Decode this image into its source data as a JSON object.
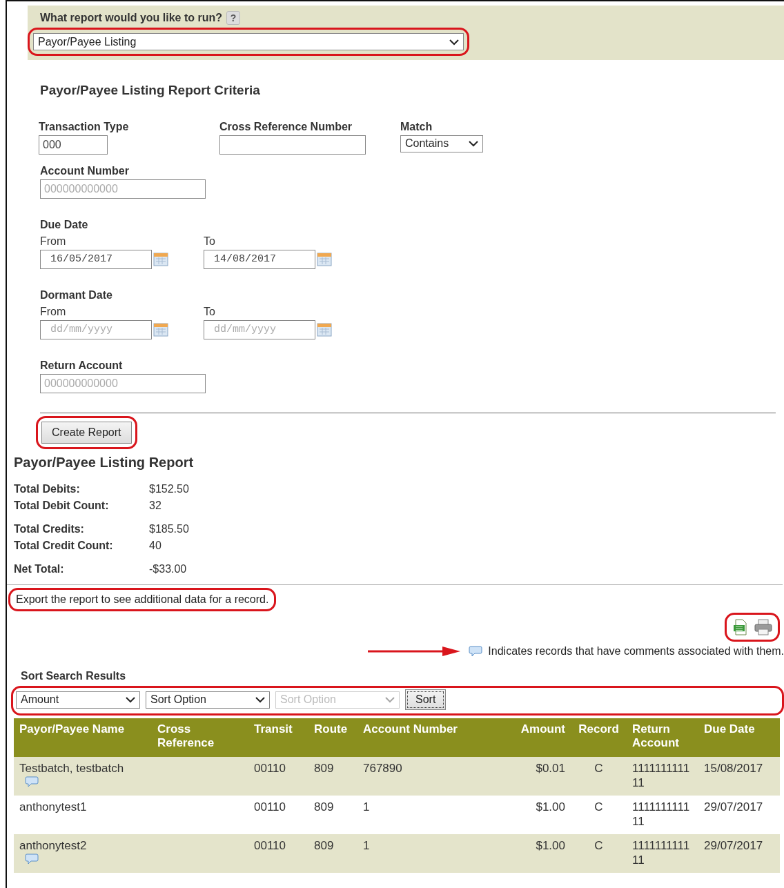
{
  "report_picker": {
    "label": "What report would you like to run?",
    "help": "?",
    "value": "Payor/Payee Listing",
    "highlighted": true
  },
  "criteria": {
    "title": "Payor/Payee Listing Report Criteria",
    "row": [
      {
        "kind": "input",
        "label": "Transaction Type",
        "value": "000"
      },
      {
        "kind": "input",
        "label": "Cross Reference Number"
      },
      {
        "kind": "select",
        "label": "Match",
        "value": "Contains"
      }
    ],
    "account_number": {
      "label": "Account Number",
      "placeholder": "000000000000"
    },
    "date_groups": [
      {
        "label": "Due Date",
        "from": {
          "label": "From",
          "value": "16/05/2017"
        },
        "to": {
          "label": "To",
          "value": "14/08/2017"
        }
      },
      {
        "label": "Dormant Date",
        "from": {
          "label": "From",
          "placeholder": "dd/mm/yyyy"
        },
        "to": {
          "label": "To",
          "placeholder": "dd/mm/yyyy"
        }
      }
    ],
    "return_account": {
      "label": "Return Account",
      "placeholder": "000000000000"
    }
  },
  "create_button": {
    "label": "Create Report",
    "highlighted": true
  },
  "report": {
    "title": "Payor/Payee Listing Report",
    "total_groups": [
      [
        {
          "label": "Total Debits:",
          "value": "$152.50"
        },
        {
          "label": "Total Debit Count:",
          "value": "32"
        }
      ],
      [
        {
          "label": "Total Credits:",
          "value": "$185.50"
        },
        {
          "label": "Total Credit Count:",
          "value": "40"
        }
      ],
      [
        {
          "label": "Net Total:",
          "value": "-$33.00"
        }
      ]
    ]
  },
  "export_note": {
    "text": "Export the report to see additional data for a record.",
    "highlighted": true
  },
  "export_tools": {
    "highlighted": true
  },
  "legend": {
    "text": "Indicates records that have comments associated with them.",
    "arrow": true
  },
  "sort": {
    "title": "Sort Search Results",
    "highlighted": true,
    "selects": [
      {
        "value": "Amount",
        "disabled": false
      },
      {
        "value": "Sort Option",
        "disabled": false
      },
      {
        "value": "Sort Option",
        "disabled": true
      }
    ],
    "button": "Sort"
  },
  "table": {
    "columns": [
      "Payor/Payee Name",
      "Cross Reference",
      "Transit",
      "Route",
      "Account Number",
      "Amount",
      "Record",
      "Return Account",
      "Due Date"
    ],
    "rows": [
      {
        "cells": [
          "Testbatch, testbatch",
          "",
          "00110",
          "809",
          "767890",
          "$0.01",
          "C",
          "111111111111",
          "15/08/2017"
        ],
        "has_comment": true
      },
      {
        "cells": [
          "anthonytest1",
          "",
          "00110",
          "809",
          "1",
          "$1.00",
          "C",
          "111111111111",
          "29/07/2017"
        ],
        "has_comment": false
      },
      {
        "cells": [
          "anthonytest2",
          "",
          "00110",
          "809",
          "1",
          "$1.00",
          "C",
          "111111111111",
          "29/07/2017"
        ],
        "has_comment": true
      }
    ]
  }
}
